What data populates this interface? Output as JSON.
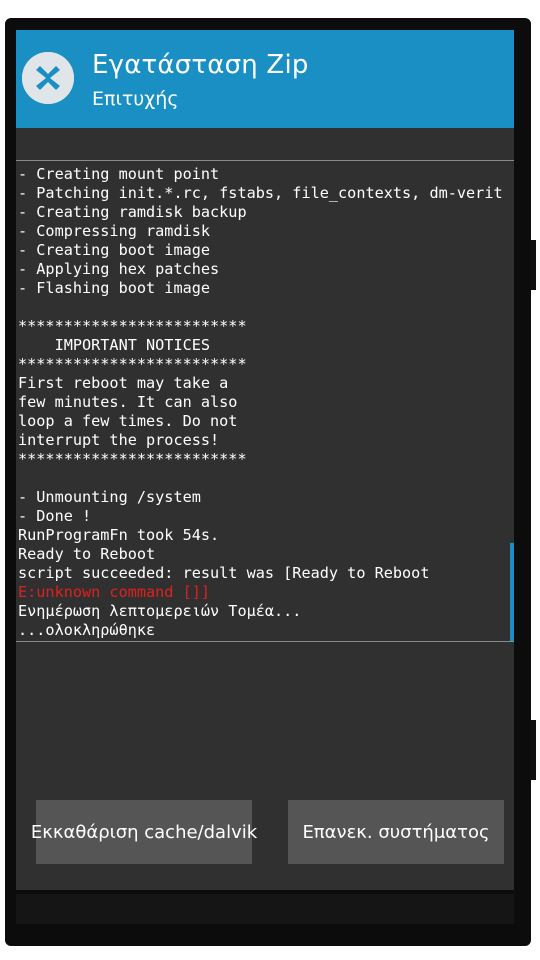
{
  "header": {
    "title": "Εγατάσταση Zip",
    "subtitle": "Επιτυχής",
    "logo_icon": "twrp-logo-icon",
    "accent_color": "#1a8fc4"
  },
  "console": {
    "lines": [
      {
        "text": "- Creating mount point"
      },
      {
        "text": "- Patching init.*.rc, fstabs, file_contexts, dm-verit"
      },
      {
        "text": "- Creating ramdisk backup"
      },
      {
        "text": "- Compressing ramdisk"
      },
      {
        "text": "- Creating boot image"
      },
      {
        "text": "- Applying hex patches"
      },
      {
        "text": "- Flashing boot image"
      },
      {
        "text": ""
      },
      {
        "text": "*************************"
      },
      {
        "text": "    IMPORTANT NOTICES"
      },
      {
        "text": "*************************"
      },
      {
        "text": "First reboot may take a"
      },
      {
        "text": "few minutes. It can also"
      },
      {
        "text": "loop a few times. Do not"
      },
      {
        "text": "interrupt the process!"
      },
      {
        "text": "*************************"
      },
      {
        "text": ""
      },
      {
        "text": "- Unmounting /system"
      },
      {
        "text": "- Done !"
      },
      {
        "text": "RunProgramFn took 54s."
      },
      {
        "text": "Ready to Reboot"
      },
      {
        "text": "script succeeded: result was [Ready to Reboot"
      },
      {
        "text": "E:unknown command []]",
        "error": true
      },
      {
        "text": "Ενημέρωση λεπτομερειών Τομέα..."
      },
      {
        "text": "...ολοκληρώθηκε"
      }
    ],
    "error_color": "#e02020"
  },
  "buttons": {
    "wipe_label": "Εκκαθάριση cache/dalvik",
    "reboot_label": "Επανεκ. συστήματος"
  }
}
